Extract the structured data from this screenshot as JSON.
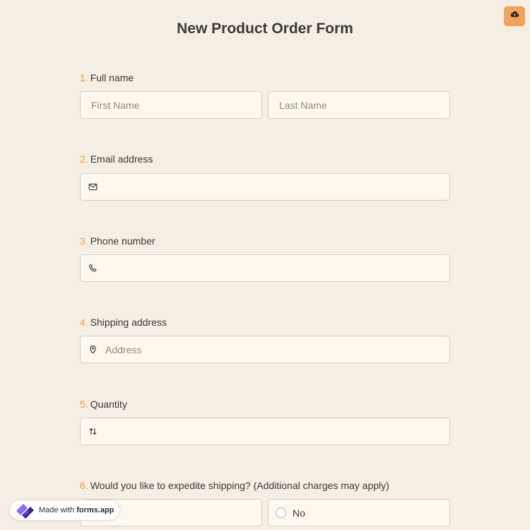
{
  "form": {
    "title": "New Product Order Form"
  },
  "corner_button": {
    "icon": "cloud-upload-icon",
    "color": "#eea25f"
  },
  "questions": [
    {
      "number": "1.",
      "label": "Full name",
      "first_placeholder": "First Name",
      "last_placeholder": "Last Name"
    },
    {
      "number": "2.",
      "label": "Email address",
      "icon": "envelope-icon",
      "placeholder": ""
    },
    {
      "number": "3.",
      "label": "Phone number",
      "icon": "phone-icon",
      "placeholder": ""
    },
    {
      "number": "4.",
      "label": "Shipping address",
      "icon": "map-pin-icon",
      "placeholder": "Address"
    },
    {
      "number": "5.",
      "label": "Quantity",
      "icon": "number-arrows-icon",
      "placeholder": ""
    },
    {
      "number": "6.",
      "label": "Would you like to expedite shipping? (Additional charges may apply)",
      "options": [
        "No"
      ]
    }
  ],
  "badge": {
    "prefix": "Made with",
    "brand": "forms.app"
  },
  "colors": {
    "background": "#f6ede3",
    "accent": "#e7a25e",
    "field_bg": "#fff8ef",
    "brand_logo": "#6b4de6"
  }
}
